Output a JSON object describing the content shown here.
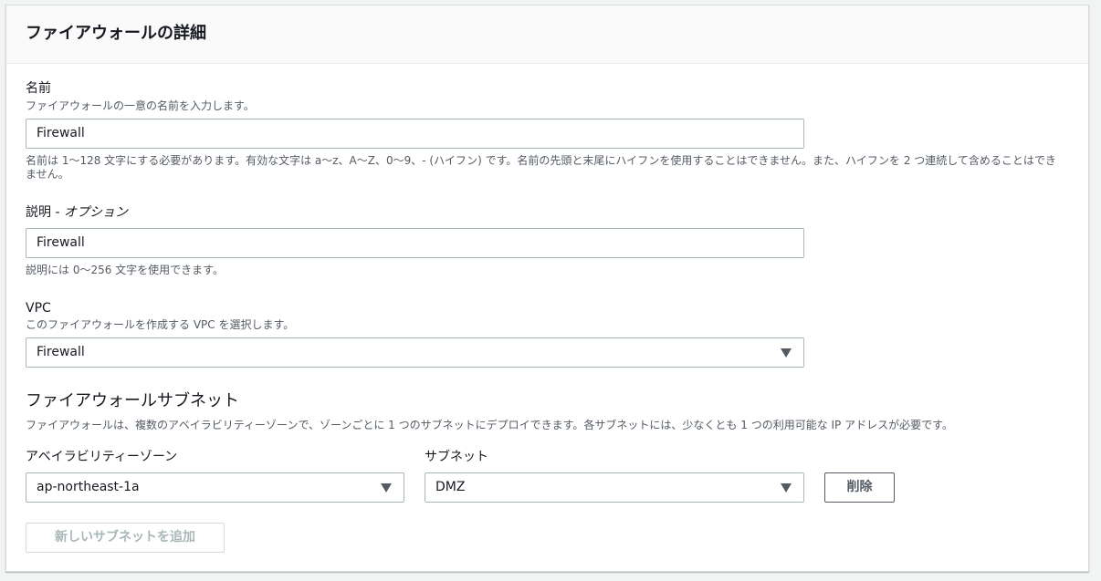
{
  "panel": {
    "title": "ファイアウォールの詳細"
  },
  "name_field": {
    "label": "名前",
    "description": "ファイアウォールの一意の名前を入力します。",
    "value": "Firewall",
    "constraint": "名前は 1〜128 文字にする必要があります。有効な文字は a〜z、A〜Z、0〜9、- (ハイフン) です。名前の先頭と末尾にハイフンを使用することはできません。また、ハイフンを 2 つ連続して含めることはできません。"
  },
  "description_field": {
    "label": "説明 - ",
    "label_optional": "オプション",
    "value": "Firewall",
    "constraint": "説明には 0〜256 文字を使用できます。"
  },
  "vpc_field": {
    "label": "VPC",
    "description": "このファイアウォールを作成する VPC を選択します。",
    "selected": "Firewall"
  },
  "subnets": {
    "title": "ファイアウォールサブネット",
    "description": "ファイアウォールは、複数のアベイラビリティーゾーンで、ゾーンごとに 1 つのサブネットにデプロイできます。各サブネットには、少なくとも 1 つの利用可能な IP アドレスが必要です。",
    "az_label": "アベイラビリティーゾーン",
    "subnet_label": "サブネット",
    "rows": [
      {
        "az": "ap-northeast-1a",
        "subnet": "DMZ",
        "remove_label": "削除"
      }
    ],
    "add_button_label": "新しいサブネットを追加"
  },
  "icons": {
    "dropdown": "caret-down-icon"
  }
}
